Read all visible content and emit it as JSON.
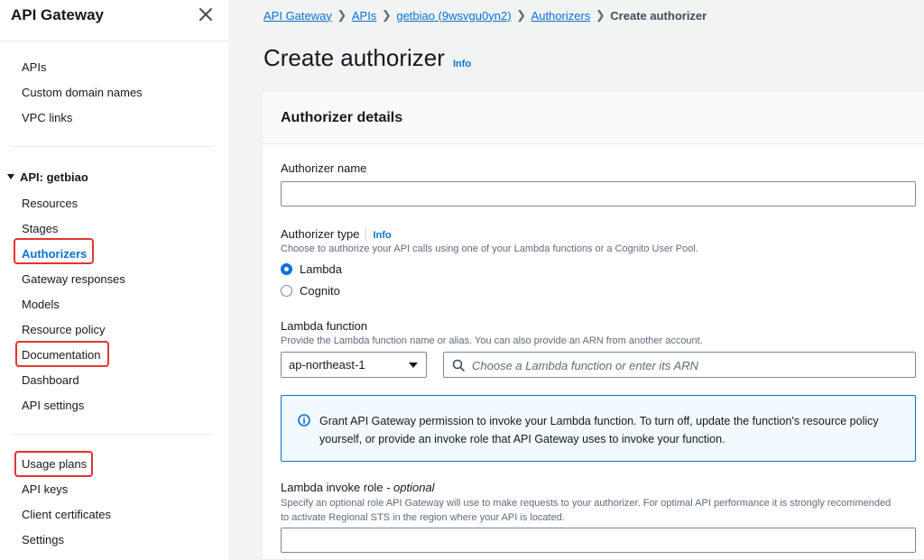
{
  "sidebar": {
    "title": "API Gateway",
    "top_items": [
      "APIs",
      "Custom domain names",
      "VPC links"
    ],
    "section_label": "API: getbiao",
    "api_items": [
      "Resources",
      "Stages",
      "Authorizers",
      "Gateway responses",
      "Models",
      "Resource policy",
      "Documentation",
      "Dashboard",
      "API settings"
    ],
    "bottom_items": [
      "Usage plans",
      "API keys",
      "Client certificates",
      "Settings"
    ]
  },
  "breadcrumb": {
    "items": [
      "API Gateway",
      "APIs",
      "getbiao (9wsvgu0yn2)",
      "Authorizers"
    ],
    "current": "Create authorizer"
  },
  "page": {
    "title": "Create authorizer",
    "info": "Info"
  },
  "form": {
    "section_title": "Authorizer details",
    "name_label": "Authorizer name",
    "name_value": "",
    "type_label": "Authorizer type",
    "type_info": "Info",
    "type_desc": "Choose to authorize your API calls using one of your Lambda functions or a Cognito User Pool.",
    "type_options": [
      "Lambda",
      "Cognito"
    ],
    "type_selected": "Lambda",
    "lambda_label": "Lambda function",
    "lambda_desc": "Provide the Lambda function name or alias. You can also provide an ARN from another account.",
    "region_value": "ap-northeast-1",
    "lambda_placeholder": "Choose a Lambda function or enter its ARN",
    "alert_text": "Grant API Gateway permission to invoke your Lambda function. To turn off, update the function's resource policy yourself, or provide an invoke role that API Gateway uses to invoke your function.",
    "invoke_role_label": "Lambda invoke role",
    "invoke_role_optional": "- optional",
    "invoke_role_desc_1": "Specify an optional role API Gateway will use to make requests to your authorizer. For optimal API performance it is strongly recommended",
    "invoke_role_desc_2": "to activate Regional STS in the region where your API is located.",
    "invoke_role_value": ""
  },
  "colors": {
    "link": "#0972d3",
    "highlight": "#e3342f",
    "alert_bg": "#f1faff"
  },
  "icons": [
    "close-icon",
    "caret-down-icon",
    "chevron-right-icon",
    "search-icon",
    "info-circle-icon",
    "dropdown-arrow-icon"
  ]
}
